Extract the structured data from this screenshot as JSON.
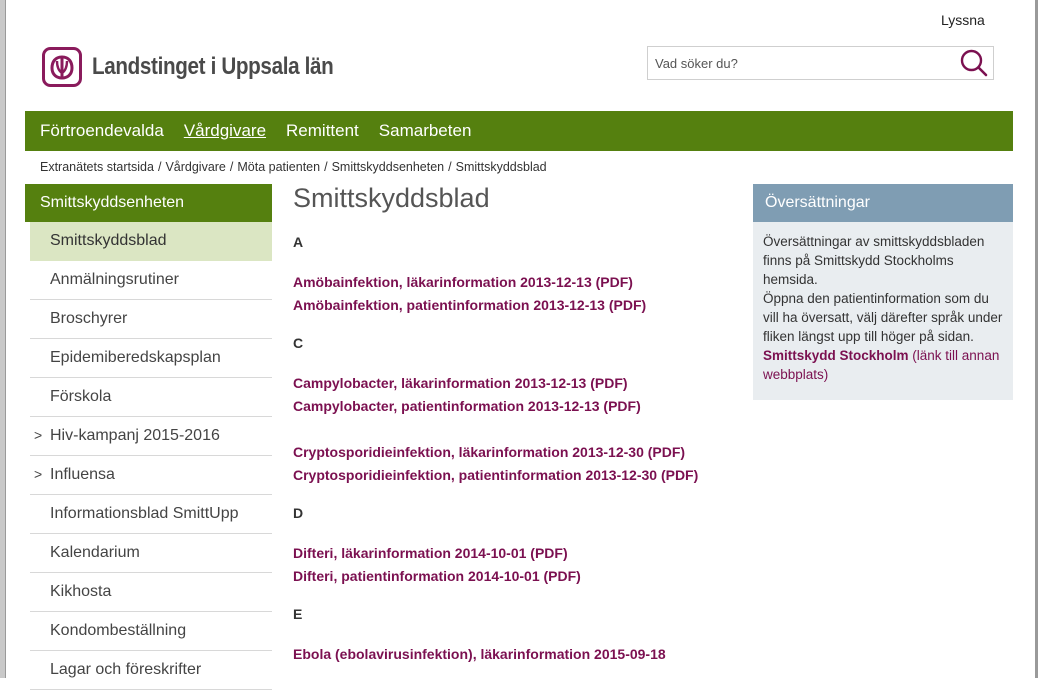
{
  "header": {
    "listen_label": "Lyssna",
    "logo_text": "Landstinget i Uppsala län",
    "logo_icon": "landstinget-logo-icon",
    "search": {
      "placeholder": "Vad söker du?",
      "icon": "search-icon"
    }
  },
  "topnav": {
    "items": [
      {
        "label": "Förtroendevalda",
        "active": false
      },
      {
        "label": "Vårdgivare",
        "active": true
      },
      {
        "label": "Remittent",
        "active": false
      },
      {
        "label": "Samarbeten",
        "active": false
      }
    ]
  },
  "breadcrumb": {
    "items": [
      "Extranätets startsida",
      "Vårdgivare",
      "Möta patienten",
      "Smittskyddsenheten"
    ],
    "current": "Smittskyddsblad",
    "separator": "/"
  },
  "sidebar": {
    "heading": "Smittskyddsenheten",
    "items": [
      {
        "label": "Smittskyddsblad",
        "active": true,
        "expandable": false
      },
      {
        "label": "Anmälningsrutiner",
        "active": false,
        "expandable": false
      },
      {
        "label": "Broschyrer",
        "active": false,
        "expandable": false
      },
      {
        "label": "Epidemiberedskapsplan",
        "active": false,
        "expandable": false
      },
      {
        "label": "Förskola",
        "active": false,
        "expandable": false
      },
      {
        "label": "Hiv-kampanj 2015-2016",
        "active": false,
        "expandable": true
      },
      {
        "label": "Influensa",
        "active": false,
        "expandable": true
      },
      {
        "label": "Informationsblad SmittUpp",
        "active": false,
        "expandable": false
      },
      {
        "label": "Kalendarium",
        "active": false,
        "expandable": false
      },
      {
        "label": "Kikhosta",
        "active": false,
        "expandable": false
      },
      {
        "label": "Kondombeställning",
        "active": false,
        "expandable": false
      },
      {
        "label": "Lagar och föreskrifter",
        "active": false,
        "expandable": false
      }
    ],
    "chevron_glyph": ">"
  },
  "main": {
    "title": "Smittskyddsblad",
    "sections": {
      "a": {
        "letter": "A",
        "links": [
          "Amöbainfektion, läkarinformation 2013-12-13 (PDF)",
          "Amöbainfektion, patientinformation 2013-12-13 (PDF)"
        ]
      },
      "c": {
        "letter": "C",
        "links": [
          "Campylobacter, läkarinformation 2013-12-13 (PDF)",
          "Campylobacter, patientinformation 2013-12-13 (PDF)"
        ],
        "links2": [
          "Cryptosporidieinfektion, läkarinformation 2013-12-30 (PDF)",
          "Cryptosporidieinfektion, patientinformation 2013-12-30  (PDF)"
        ]
      },
      "d": {
        "letter": "D",
        "links": [
          "Difteri, läkarinformation 2014-10-01 (PDF)",
          "Difteri, patientinformation 2014-10-01 (PDF)"
        ]
      },
      "e": {
        "letter": "E",
        "links": [
          "Ebola (ebolavirusinfektion), läkarinformation 2015-09-18"
        ]
      }
    }
  },
  "aside": {
    "heading": "Översättningar",
    "text1": "Översättningar av smittskyddsbladen finns på Smittskydd Stockholms hemsida.",
    "text2": "Öppna den patientinformation som du vill ha översatt, välj därefter språk under fliken längst upp till höger på sidan.",
    "link_strong": "Smittskydd Stockholm",
    "link_rest": " (länk till annan webbplats)"
  },
  "colors": {
    "nav_green": "#55800f",
    "active_item_bg": "#dbe6c3",
    "link_purple": "#7b1050",
    "aside_head": "#7f9db3",
    "aside_body": "#e9edf0"
  }
}
